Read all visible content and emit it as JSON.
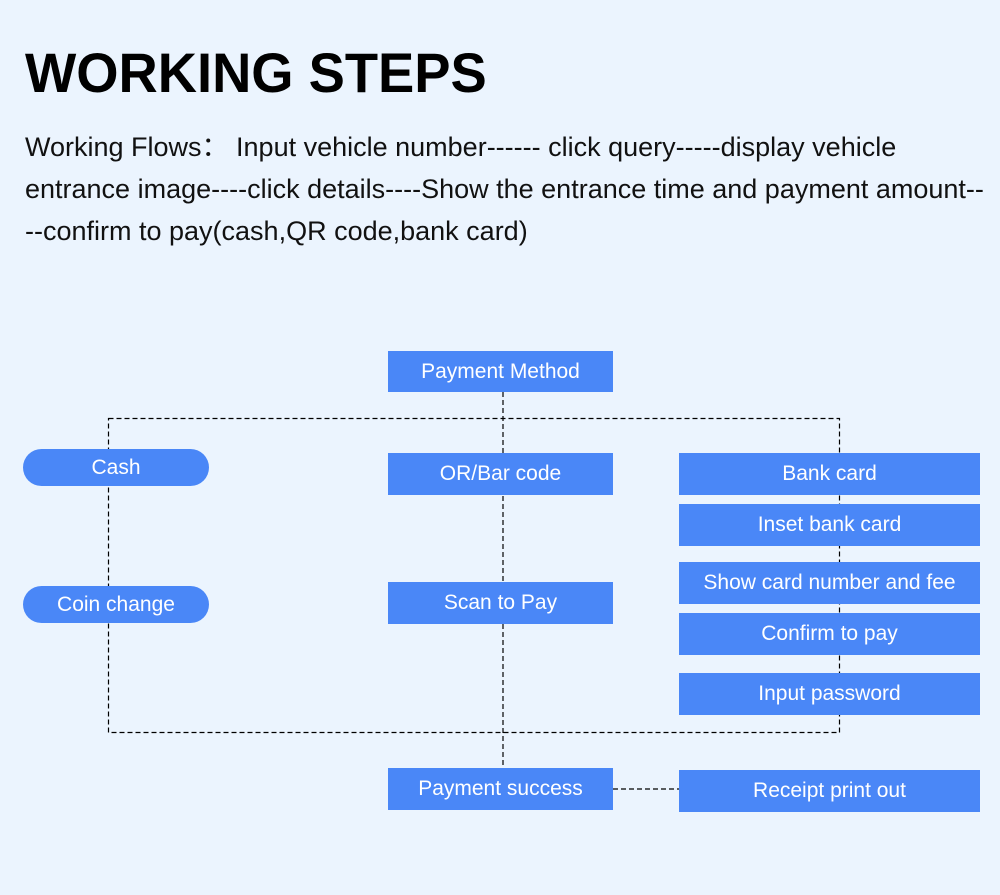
{
  "header": {
    "title": "WORKING STEPS",
    "description": "Working Flows： Input vehicle number------ click query-----display vehicle entrance image----click details----Show the entrance time and payment amount----confirm to pay(cash,QR code,bank card)"
  },
  "colors": {
    "background": "#ebf4fe",
    "box_fill": "#4a87f7",
    "box_text": "#ffffff",
    "connector": "#000000"
  },
  "diagram": {
    "root": "Payment Method",
    "cash_branch": [
      "Cash",
      "Coin change"
    ],
    "qr_branch": [
      "OR/Bar code",
      "Scan to Pay"
    ],
    "bank_branch": [
      "Bank card",
      "Inset bank card",
      "Show card number and fee",
      "Confirm to pay",
      "Input password"
    ],
    "result": "Payment success",
    "final": "Receipt print out"
  }
}
